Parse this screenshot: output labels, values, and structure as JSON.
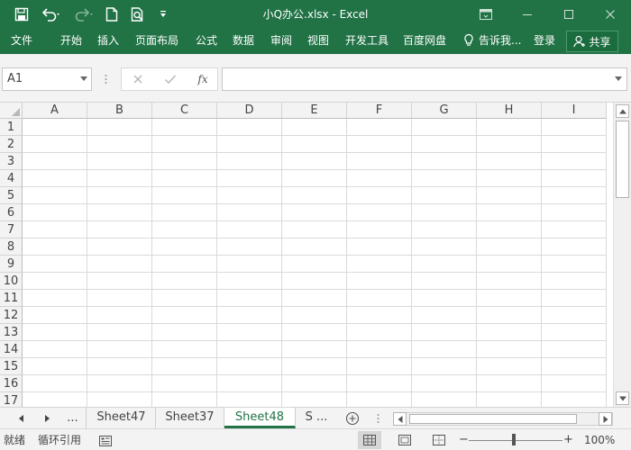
{
  "titlebar": {
    "title": "小Q办公.xlsx  -  Excel",
    "quick_access": [
      "save-icon",
      "undo-icon",
      "redo-icon",
      "new-file-icon",
      "print-preview-icon",
      "customize-icon"
    ],
    "window_controls": [
      "ribbon-display-icon",
      "minimize-icon",
      "maximize-icon",
      "close-icon"
    ]
  },
  "ribbon": {
    "tabs": [
      "文件",
      "开始",
      "插入",
      "页面布局",
      "公式",
      "数据",
      "审阅",
      "视图",
      "开发工具",
      "百度网盘"
    ],
    "tell_me": "告诉我...",
    "login": "登录",
    "share": "共享"
  },
  "formula_bar": {
    "name_box": "A1",
    "formula": "",
    "fx_label": "fx"
  },
  "grid": {
    "columns": [
      "A",
      "B",
      "C",
      "D",
      "E",
      "F",
      "G",
      "H",
      "I"
    ],
    "rows": [
      "1",
      "2",
      "3",
      "4",
      "5",
      "6",
      "7",
      "8",
      "9",
      "10",
      "11",
      "12",
      "13",
      "14",
      "15",
      "16",
      "17"
    ]
  },
  "sheets": {
    "more_left": "...",
    "tabs": [
      "Sheet47",
      "Sheet37",
      "Sheet48",
      "S ..."
    ],
    "active_index": 2
  },
  "status": {
    "ready": "就绪",
    "circular": "循环引用",
    "zoom": "100%",
    "zoom_minus": "−",
    "zoom_plus": "+"
  },
  "colors": {
    "accent": "#217346",
    "grid_line": "#dadada",
    "header_bg": "#f3f3f3"
  }
}
